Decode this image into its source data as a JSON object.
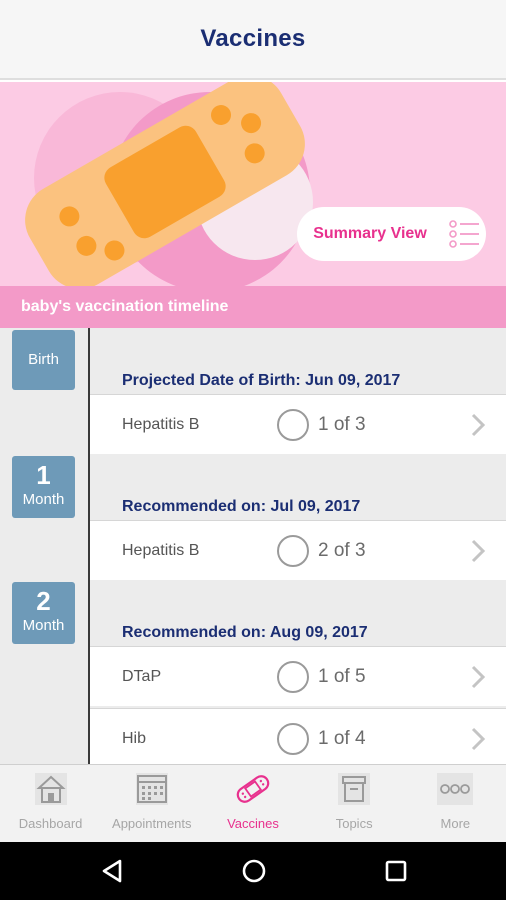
{
  "header": {
    "title": "Vaccines"
  },
  "hero": {
    "summary_label": "Summary View",
    "timeline_label": "baby's vaccination timeline"
  },
  "timeline": {
    "groups": [
      {
        "age_number": "",
        "age_unit": "Birth",
        "title": "Projected Date of Birth: Jun 09, 2017",
        "vaccines": [
          {
            "name": "Hepatitis B",
            "dose": "1 of 3"
          }
        ]
      },
      {
        "age_number": "1",
        "age_unit": "Month",
        "title": "Recommended on: Jul 09, 2017",
        "vaccines": [
          {
            "name": "Hepatitis B",
            "dose": "2 of 3"
          }
        ]
      },
      {
        "age_number": "2",
        "age_unit": "Month",
        "title": "Recommended on: Aug 09, 2017",
        "vaccines": [
          {
            "name": "DTaP",
            "dose": "1 of 5"
          },
          {
            "name": "Hib",
            "dose": "1 of 4"
          }
        ]
      }
    ]
  },
  "tabbar": {
    "items": [
      {
        "label": "Dashboard",
        "icon": "house-icon"
      },
      {
        "label": "Appointments",
        "icon": "calendar-icon"
      },
      {
        "label": "Vaccines",
        "icon": "bandage-icon"
      },
      {
        "label": "Topics",
        "icon": "box-icon"
      },
      {
        "label": "More",
        "icon": "more-icon"
      }
    ],
    "active": "Vaccines"
  },
  "colors": {
    "accent": "#e8318e",
    "title": "#1b2e73",
    "age_badge": "#6e9ab8",
    "hero_bg": "#fccbe4",
    "banner": "#f39ac8"
  }
}
